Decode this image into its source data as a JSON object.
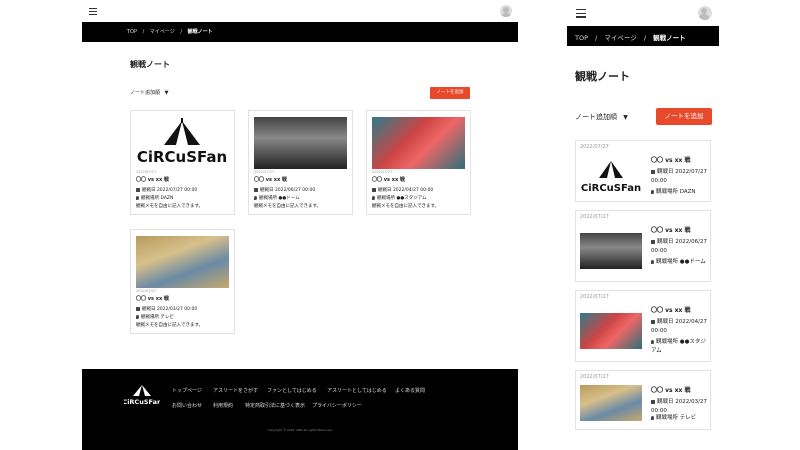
{
  "breadcrumb": {
    "top": "TOP",
    "sep": "/",
    "mypage": "マイページ",
    "current": "観戦ノート"
  },
  "page_title": "観戦ノート",
  "sort_label": "ノート追加順",
  "add_button": "ノートを追加",
  "logo_text": "CiRCuSFan",
  "cards": [
    {
      "date": "2022/07/27",
      "title": "〇〇 vs xx 戦",
      "watch_date_label": "観戦日",
      "watch_date": "2022/07/27 00:00",
      "place_label": "観戦場所",
      "place": "DAZN",
      "memo": "観戦メモを自由に記入できます。"
    },
    {
      "date": "2022/07/27",
      "title": "〇〇 vs xx 戦",
      "watch_date_label": "観戦日",
      "watch_date": "2022/06/27 00:00",
      "place_label": "観戦場所",
      "place": "●●ドーム",
      "memo": "観戦メモを自由に記入できます。"
    },
    {
      "date": "2022/07/27",
      "title": "〇〇 vs xx 戦",
      "watch_date_label": "観戦日",
      "watch_date": "2022/04/27 00:00",
      "place_label": "観戦場所",
      "place": "●●スタジアム",
      "memo": "観戦メモを自由に記入できます。"
    },
    {
      "date": "2022/07/27",
      "title": "〇〇 vs xx 戦",
      "watch_date_label": "観戦日",
      "watch_date": "2022/03/27 00:00",
      "place_label": "観戦場所",
      "place": "テレビ",
      "memo": "観戦メモを自由に記入できます。"
    }
  ],
  "footer": {
    "links_row1": [
      "トップページ",
      "アスリートをさがす",
      "ファンとしてはじめる",
      "アスリートとしてはじめる",
      "よくある質問"
    ],
    "links_row2": [
      "お問い合わせ",
      "利用規約",
      "特定商取引法に基づく表示",
      "プライバシーポリシー"
    ],
    "copyright": "Copyright © 2021 CIRC.all rights Reserved."
  },
  "colors": {
    "accent": "#e8492a",
    "bar": "#000000"
  },
  "icons": {
    "menu": "hamburger-icon",
    "user": "avatar-icon",
    "calendar": "calendar-icon",
    "place": "pin-icon",
    "sort": "caret-down-icon"
  }
}
